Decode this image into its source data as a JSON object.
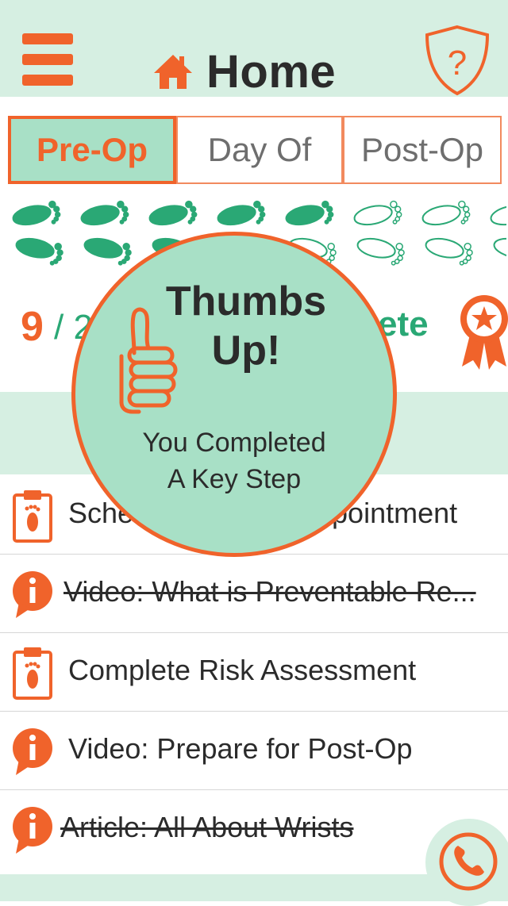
{
  "header": {
    "title": "Home",
    "menu_icon": "hamburger-menu-icon",
    "home_icon": "house-icon",
    "help_icon": "shield-question-icon"
  },
  "tabs": [
    {
      "label": "Pre-Op",
      "active": true
    },
    {
      "label": "Day Of",
      "active": false
    },
    {
      "label": "Post-Op",
      "active": false
    }
  ],
  "progress": {
    "completed_steps": 9,
    "count_text": "9",
    "slash_text": "/ 2",
    "label_fragment": "ete",
    "total_footprints": 16,
    "filled_footprints": 9,
    "award_icon": "ribbon-star-icon"
  },
  "tasks": [
    {
      "label": "Schedule Appointment",
      "visible_left": "Sche",
      "visible_right": "ppointment",
      "icon": "clipboard-foot-icon",
      "done": false
    },
    {
      "label": "Video: What is Preventable Re...",
      "icon": "info-bubble-icon",
      "done": true
    },
    {
      "label": "Complete Risk Assessment",
      "icon": "clipboard-foot-icon",
      "done": false
    },
    {
      "label": "Video: Prepare for Post-Op",
      "icon": "info-bubble-icon",
      "done": false
    },
    {
      "label": "Article: All About Wrists",
      "icon": "info-bubble-icon",
      "done": true
    }
  ],
  "popup": {
    "title_line1": "Thumbs",
    "title_line2": "Up!",
    "message_line1": "You Completed",
    "message_line2": "A Key Step",
    "icon": "thumbs-up-icon"
  },
  "call_button": {
    "icon": "phone-icon"
  },
  "colors": {
    "accent_orange": "#f0632b",
    "mint": "#a8e0c6",
    "light_mint": "#d6efe2",
    "green": "#2aa875",
    "text": "#2b2b2b"
  }
}
